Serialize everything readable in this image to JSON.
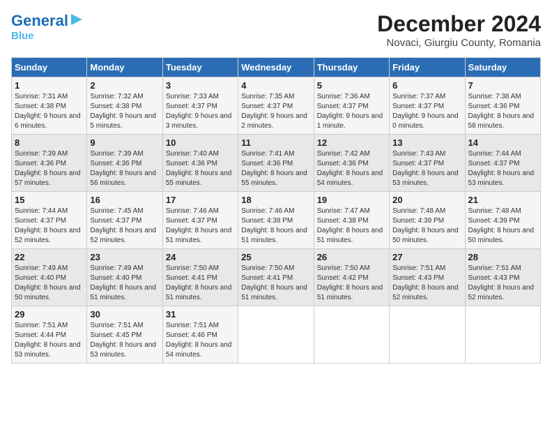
{
  "header": {
    "logo_general": "General",
    "logo_blue": "Blue",
    "month": "December 2024",
    "location": "Novaci, Giurgiu County, Romania"
  },
  "days_of_week": [
    "Sunday",
    "Monday",
    "Tuesday",
    "Wednesday",
    "Thursday",
    "Friday",
    "Saturday"
  ],
  "weeks": [
    [
      {
        "day": "1",
        "sunrise": "7:31 AM",
        "sunset": "4:38 PM",
        "daylight": "9 hours and 6 minutes."
      },
      {
        "day": "2",
        "sunrise": "7:32 AM",
        "sunset": "4:38 PM",
        "daylight": "9 hours and 5 minutes."
      },
      {
        "day": "3",
        "sunrise": "7:33 AM",
        "sunset": "4:37 PM",
        "daylight": "9 hours and 3 minutes."
      },
      {
        "day": "4",
        "sunrise": "7:35 AM",
        "sunset": "4:37 PM",
        "daylight": "9 hours and 2 minutes."
      },
      {
        "day": "5",
        "sunrise": "7:36 AM",
        "sunset": "4:37 PM",
        "daylight": "9 hours and 1 minute."
      },
      {
        "day": "6",
        "sunrise": "7:37 AM",
        "sunset": "4:37 PM",
        "daylight": "9 hours and 0 minutes."
      },
      {
        "day": "7",
        "sunrise": "7:38 AM",
        "sunset": "4:36 PM",
        "daylight": "8 hours and 58 minutes."
      }
    ],
    [
      {
        "day": "8",
        "sunrise": "7:39 AM",
        "sunset": "4:36 PM",
        "daylight": "8 hours and 57 minutes."
      },
      {
        "day": "9",
        "sunrise": "7:39 AM",
        "sunset": "4:36 PM",
        "daylight": "8 hours and 56 minutes."
      },
      {
        "day": "10",
        "sunrise": "7:40 AM",
        "sunset": "4:36 PM",
        "daylight": "8 hours and 55 minutes."
      },
      {
        "day": "11",
        "sunrise": "7:41 AM",
        "sunset": "4:36 PM",
        "daylight": "8 hours and 55 minutes."
      },
      {
        "day": "12",
        "sunrise": "7:42 AM",
        "sunset": "4:36 PM",
        "daylight": "8 hours and 54 minutes."
      },
      {
        "day": "13",
        "sunrise": "7:43 AM",
        "sunset": "4:37 PM",
        "daylight": "8 hours and 53 minutes."
      },
      {
        "day": "14",
        "sunrise": "7:44 AM",
        "sunset": "4:37 PM",
        "daylight": "8 hours and 53 minutes."
      }
    ],
    [
      {
        "day": "15",
        "sunrise": "7:44 AM",
        "sunset": "4:37 PM",
        "daylight": "8 hours and 52 minutes."
      },
      {
        "day": "16",
        "sunrise": "7:45 AM",
        "sunset": "4:37 PM",
        "daylight": "8 hours and 52 minutes."
      },
      {
        "day": "17",
        "sunrise": "7:46 AM",
        "sunset": "4:37 PM",
        "daylight": "8 hours and 51 minutes."
      },
      {
        "day": "18",
        "sunrise": "7:46 AM",
        "sunset": "4:38 PM",
        "daylight": "8 hours and 51 minutes."
      },
      {
        "day": "19",
        "sunrise": "7:47 AM",
        "sunset": "4:38 PM",
        "daylight": "8 hours and 51 minutes."
      },
      {
        "day": "20",
        "sunrise": "7:48 AM",
        "sunset": "4:39 PM",
        "daylight": "8 hours and 50 minutes."
      },
      {
        "day": "21",
        "sunrise": "7:48 AM",
        "sunset": "4:39 PM",
        "daylight": "8 hours and 50 minutes."
      }
    ],
    [
      {
        "day": "22",
        "sunrise": "7:49 AM",
        "sunset": "4:40 PM",
        "daylight": "8 hours and 50 minutes."
      },
      {
        "day": "23",
        "sunrise": "7:49 AM",
        "sunset": "4:40 PM",
        "daylight": "8 hours and 51 minutes."
      },
      {
        "day": "24",
        "sunrise": "7:50 AM",
        "sunset": "4:41 PM",
        "daylight": "8 hours and 51 minutes."
      },
      {
        "day": "25",
        "sunrise": "7:50 AM",
        "sunset": "4:41 PM",
        "daylight": "8 hours and 51 minutes."
      },
      {
        "day": "26",
        "sunrise": "7:50 AM",
        "sunset": "4:42 PM",
        "daylight": "8 hours and 51 minutes."
      },
      {
        "day": "27",
        "sunrise": "7:51 AM",
        "sunset": "4:43 PM",
        "daylight": "8 hours and 52 minutes."
      },
      {
        "day": "28",
        "sunrise": "7:51 AM",
        "sunset": "4:43 PM",
        "daylight": "8 hours and 52 minutes."
      }
    ],
    [
      {
        "day": "29",
        "sunrise": "7:51 AM",
        "sunset": "4:44 PM",
        "daylight": "8 hours and 53 minutes."
      },
      {
        "day": "30",
        "sunrise": "7:51 AM",
        "sunset": "4:45 PM",
        "daylight": "8 hours and 53 minutes."
      },
      {
        "day": "31",
        "sunrise": "7:51 AM",
        "sunset": "4:46 PM",
        "daylight": "8 hours and 54 minutes."
      },
      null,
      null,
      null,
      null
    ]
  ]
}
